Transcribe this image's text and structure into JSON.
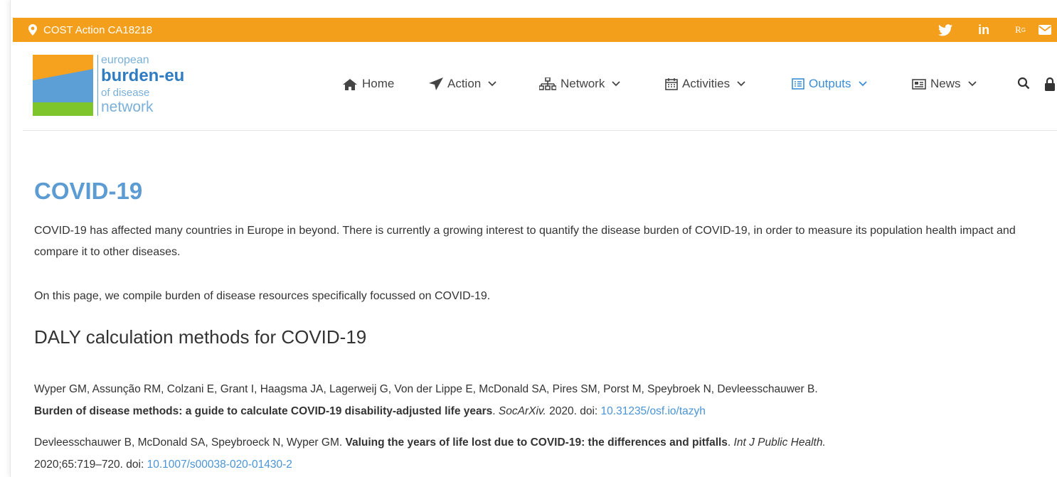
{
  "topbar": {
    "location": "COST Action CA18218",
    "icons": [
      "map-marker-icon",
      "twitter-icon",
      "linkedin-icon",
      "researchgate-icon",
      "envelope-icon"
    ],
    "linkedin_label": "in",
    "researchgate_label": "R",
    "color": "#f49f1c"
  },
  "logo": {
    "line1": "european",
    "line2": "burden-eu",
    "line3": "of disease",
    "line4": "network"
  },
  "nav": {
    "items": [
      {
        "label": "Home",
        "icon": "home-icon"
      },
      {
        "label": "Action",
        "icon": "paper-plane-icon",
        "dropdown": true
      },
      {
        "label": "Network",
        "icon": "sitemap-icon",
        "dropdown": true
      },
      {
        "label": "Activities",
        "icon": "calendar-icon",
        "dropdown": true
      },
      {
        "label": "Outputs",
        "icon": "list-icon",
        "dropdown": true,
        "active": true
      },
      {
        "label": "News",
        "icon": "newspaper-icon",
        "dropdown": true
      }
    ],
    "active_color": "#3a8dd6"
  },
  "page": {
    "title": "COVID-19",
    "intro1": "COVID-19 has affected many countries in Europe in beyond. There is currently a growing interest to quantify the disease burden of COVID-19, in order to measure its population health impact and compare it to other diseases.",
    "intro2": "On this page, we compile burden of disease resources specifically focussed on COVID-19.",
    "section_title": "DALY calculation methods for COVID-19"
  },
  "references": [
    {
      "authors": "Wyper GM, Assunção RM, Colzani E, Grant I, Haagsma JA, Lagerweij G, Von der Lippe E, McDonald SA, Pires SM, Porst M, Speybroek N, Devleesschauwer B.",
      "title": "Burden of disease methods: a guide to calculate COVID-19 disability-adjusted life years",
      "journal": "SocArXiv.",
      "year": "2020. doi:",
      "doi": "10.31235/osf.io/tazyh"
    },
    {
      "authors": "Devleesschauwer B, McDonald SA, Speybroeck N, Wyper GM.",
      "title": "Valuing the years of life lost due to COVID-19: the differences and pitfalls",
      "journal": "Int J Public Health.",
      "year": "2020;65:719–720. doi:",
      "doi": "10.1007/s00038-020-01430-2"
    }
  ]
}
